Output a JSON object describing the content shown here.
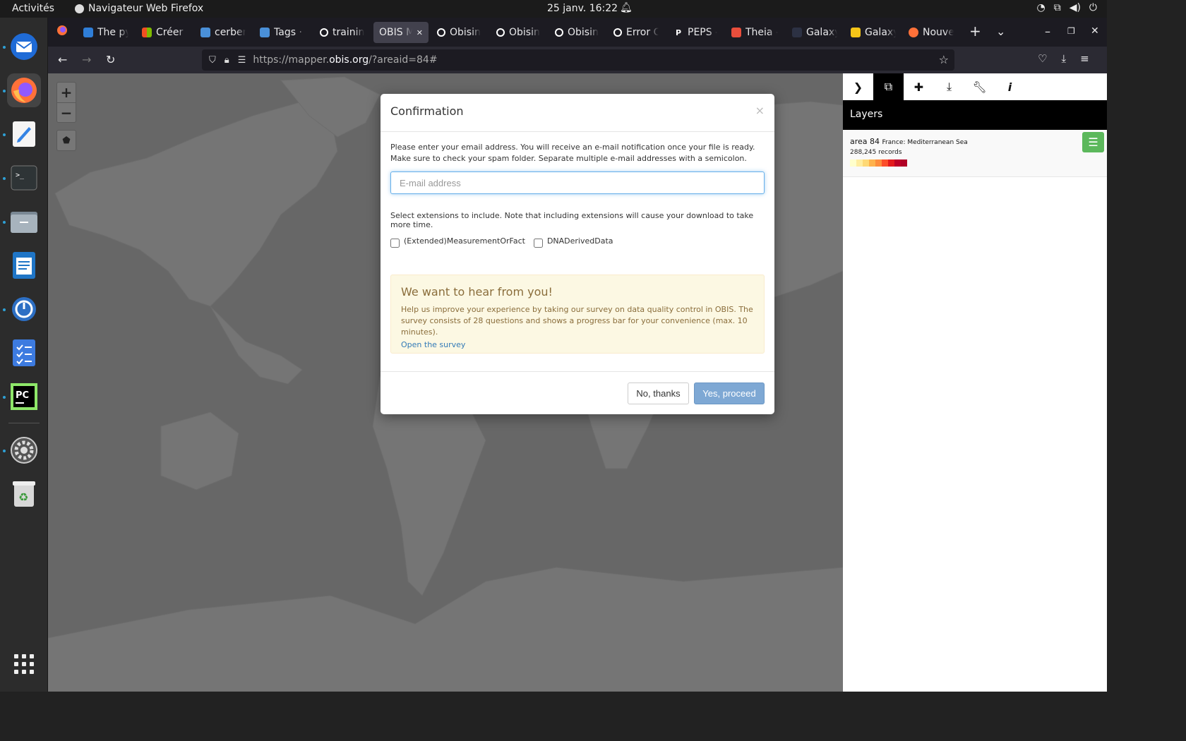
{
  "topbar": {
    "activities": "Activités",
    "app_name": "Navigateur Web Firefox",
    "clock": "25 janv.  16:22"
  },
  "browser": {
    "tabs": [
      {
        "label": "The py",
        "icon": "book-icon",
        "color": "#2f7ed8"
      },
      {
        "label": "Créer u",
        "icon": "microsoft-icon",
        "color": "#f25022"
      },
      {
        "label": "cerber",
        "icon": "gitlab-icon",
        "color": "#4a90d9"
      },
      {
        "label": "Tags · e",
        "icon": "gitlab-icon",
        "color": "#4a90d9"
      },
      {
        "label": "trainin",
        "icon": "github-icon",
        "color": "#ffffff"
      },
      {
        "label": "OBIS Ma",
        "icon": "obis-icon",
        "color": "#cccccc"
      },
      {
        "label": "Obisin",
        "icon": "github-icon",
        "color": "#ffffff"
      },
      {
        "label": "Obisin",
        "icon": "github-icon",
        "color": "#ffffff"
      },
      {
        "label": "Obisin",
        "icon": "github-icon",
        "color": "#ffffff"
      },
      {
        "label": "Error C",
        "icon": "github-icon",
        "color": "#ffffff"
      },
      {
        "label": "PEPS -",
        "icon": "peps-icon",
        "color": "#ffffff"
      },
      {
        "label": "Theia -",
        "icon": "theia-icon",
        "color": "#e94e3c"
      },
      {
        "label": "Galaxy",
        "icon": "galaxy-icon",
        "color": "#2c3143"
      },
      {
        "label": "Galaxy",
        "icon": "galaxy-icon",
        "color": "#f5c518"
      },
      {
        "label": "Nouvel",
        "icon": "firefox-icon",
        "color": "#ff7139"
      }
    ],
    "url_prefix": "https://mapper.",
    "url_domain": "obis.org",
    "url_suffix": "/?areaid=84#"
  },
  "sidebar": {
    "header": "Layers",
    "layer": {
      "name": "area 84",
      "region": "France: Mediterranean Sea",
      "records": "288,245 records",
      "scale_colors": [
        "#ffffcc",
        "#ffeda0",
        "#fed976",
        "#feb24c",
        "#fd8d3c",
        "#fc4e2a",
        "#e31a1c",
        "#bd0026",
        "#b10026"
      ]
    }
  },
  "modal": {
    "title": "Confirmation",
    "close": "×",
    "intro": "Please enter your email address. You will receive an e-mail notification once your file is ready. Make sure to check your spam folder. Separate multiple e-mail addresses with a semicolon.",
    "email_placeholder": "E-mail address",
    "extensions_text": "Select extensions to include. Note that including extensions will cause your download to take more time.",
    "ext1": "(Extended)MeasurementOrFact",
    "ext2": "DNADerivedData",
    "survey_title": "We want to hear from you!",
    "survey_text": "Help us improve your experience by taking our survey on data quality control in OBIS. The survey consists of 28 questions and shows a progress bar for your convenience (max. 10 minutes).",
    "survey_link": "Open the survey",
    "no_button": "No, thanks",
    "yes_button": "Yes, proceed"
  }
}
